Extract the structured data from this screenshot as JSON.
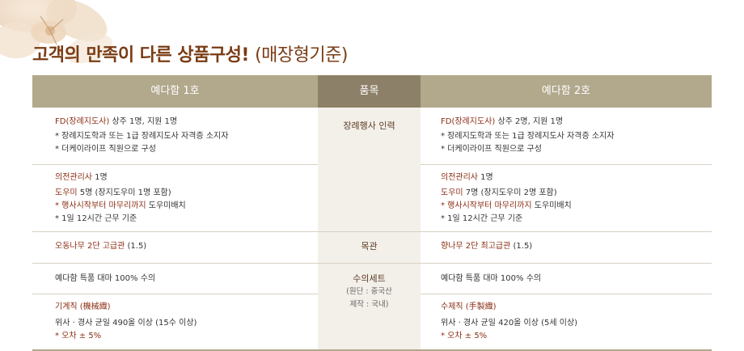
{
  "title": {
    "main": "고객의 만족이 다른 상품구성!",
    "sub": "(매장형기준)"
  },
  "headers": {
    "left": "예다함 1호",
    "middle": "품목",
    "right": "예다함 2호"
  },
  "rows": {
    "staff": {
      "item": "장례행사 인력",
      "left": {
        "line1_hl": "FD(장례지도사)",
        "line1_rest": " 상주 1명, 지원 1명",
        "line2": "* 장례지도학과 또는 1급 장례지도사 자격증 소지자",
        "line3": "* 더케이라이프 직원으로 구성"
      },
      "right": {
        "line1_hl": "FD(장례지도사)",
        "line1_rest": " 상주 2명, 지원 1명",
        "line2": "* 장례지도학과 또는 1급 장례지도사 자격증 소지자",
        "line3": "* 더케이라이프 직원으로 구성"
      }
    },
    "helpers": {
      "left": {
        "line1_hl": "의전관리사",
        "line1_rest": " 1명",
        "line2_hl": "도우미",
        "line2_rest": " 5명 (장지도우미 1명 포함)",
        "line3_hl": "* 행사시작부터 마무리까지",
        "line3_rest": " 도우미배치",
        "line4": "* 1일 12시간 근무 기준"
      },
      "right": {
        "line1_hl": "의전관리사",
        "line1_rest": " 1명",
        "line2_hl": "도우미",
        "line2_rest": " 7명 (장지도우미 2명 포함)",
        "line3_hl": "* 행사시작부터 마무리까지",
        "line3_rest": " 도우미배치",
        "line4": "* 1일 12시간 근무 기준"
      }
    },
    "coffin": {
      "item": "목관",
      "left_hl": "오동나무 2단 고급관",
      "left_rest": " (1.5)",
      "right_hl": "향나무 2단 최고급관",
      "right_rest": " (1.5)"
    },
    "shroud": {
      "item": "수의세트",
      "item_sub1": "(원단 : 중국산",
      "item_sub2": "제작 : 국내)",
      "left_line": "예다함 특품 대마 100% 수의",
      "right_line": "예다함 특품 대마 100% 수의",
      "left_type": "기계직 (機械織)",
      "left_spec": "위사 · 경사 균일 490올 이상 (15수 이상)",
      "left_tol_hl": "* 오차 ± 5%",
      "right_type": "수제직 (手製織)",
      "right_spec": "위사 · 경사 균일 420올 이상 (5세 이상)",
      "right_tol_hl": "* 오차 ± 5%"
    }
  }
}
